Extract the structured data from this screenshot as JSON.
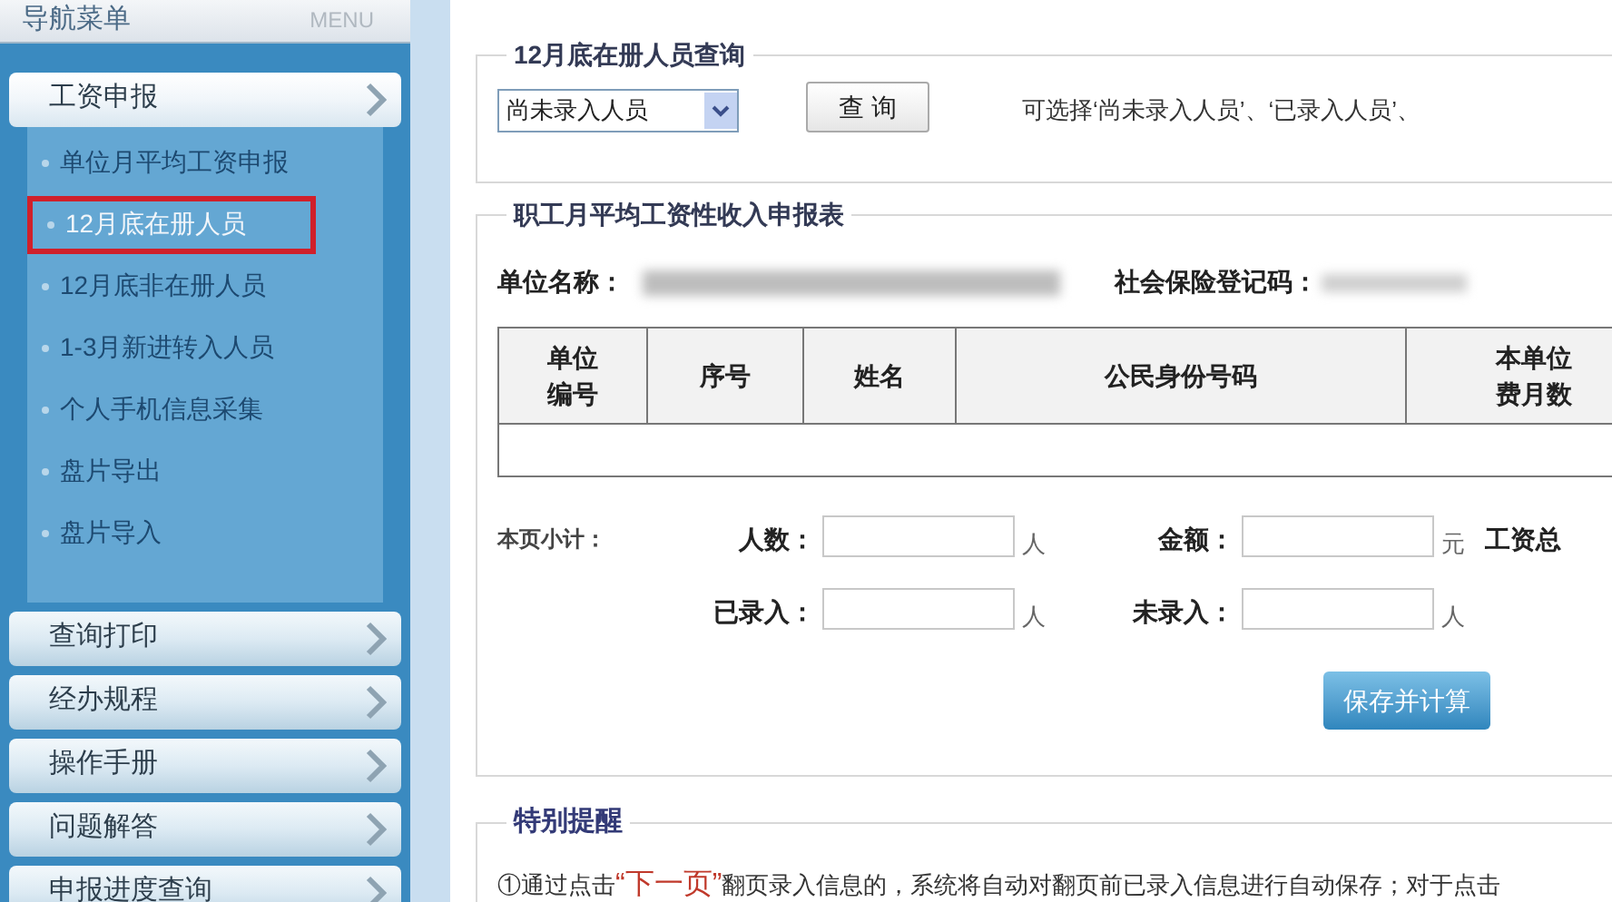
{
  "sidebar": {
    "title": "导航菜单",
    "title_en": "MENU",
    "items": [
      {
        "label": "工资申报",
        "expanded": true,
        "children": [
          {
            "label": "单位月平均工资申报",
            "selected": false
          },
          {
            "label": "12月底在册人员",
            "selected": true
          },
          {
            "label": "12月底非在册人员",
            "selected": false
          },
          {
            "label": "1-3月新进转入人员",
            "selected": false
          },
          {
            "label": "个人手机信息采集",
            "selected": false
          },
          {
            "label": "盘片导出",
            "selected": false
          },
          {
            "label": "盘片导入",
            "selected": false
          }
        ]
      },
      {
        "label": "查询打印",
        "expanded": false
      },
      {
        "label": "经办规程",
        "expanded": false
      },
      {
        "label": "操作手册",
        "expanded": false
      },
      {
        "label": "问题解答",
        "expanded": false
      },
      {
        "label": "申报进度查询",
        "expanded": false
      }
    ]
  },
  "query": {
    "legend": "12月底在册人员查询",
    "select_value": "尚未录入人员",
    "button": "查 询",
    "hint": "可选择‘尚未录入人员’、‘已录入人员’、"
  },
  "form": {
    "legend": "职工月平均工资性收入申报表",
    "unit_name_label": "单位名称：",
    "ss_code_label": "社会保险登记码：",
    "columns": [
      {
        "lines": [
          "单位",
          "编号"
        ]
      },
      {
        "lines": [
          "序号"
        ]
      },
      {
        "lines": [
          "姓名"
        ]
      },
      {
        "lines": [
          "公民身份号码"
        ]
      },
      {
        "lines": [
          "本单位",
          "费月数"
        ]
      }
    ],
    "subtotal_label": "本页小计：",
    "fields": [
      [
        {
          "label": "人数：",
          "unit": "人"
        },
        {
          "label": "金额：",
          "unit": "元"
        },
        {
          "label": "工资总"
        }
      ],
      [
        {
          "label": "已录入：",
          "unit": "人"
        },
        {
          "label": "未录入：",
          "unit": "人"
        }
      ]
    ],
    "save_button": "保存并计算"
  },
  "notice": {
    "legend": "特别提醒",
    "text": "①通过点击",
    "link": "“下一页”",
    "rest": "翻页录入信息的，系统将自动对翻页前已录入信息进行自动保存；对于点击"
  }
}
